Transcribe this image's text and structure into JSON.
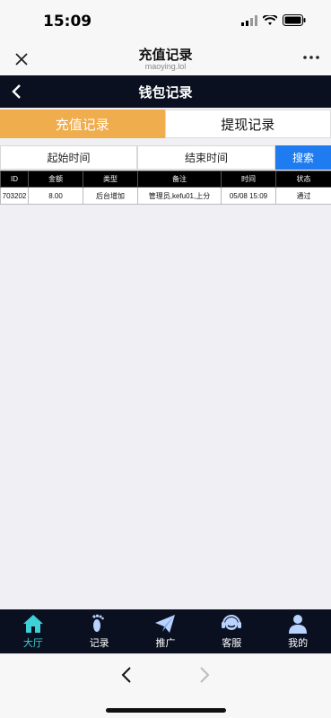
{
  "status_bar": {
    "time": "15:09"
  },
  "webview": {
    "title": "充值记录",
    "subtitle": "maoying.lol"
  },
  "app_nav": {
    "title": "钱包记录"
  },
  "tabs": [
    {
      "label": "充值记录",
      "active": true
    },
    {
      "label": "提现记录",
      "active": false
    }
  ],
  "filter": {
    "start_label": "起始时间",
    "end_label": "结束时间",
    "search_label": "搜索"
  },
  "table": {
    "headers": [
      "ID",
      "金额",
      "类型",
      "备注",
      "时间",
      "状态"
    ],
    "rows": [
      [
        "703202",
        "8.00",
        "后台增加",
        "管理员,kefu01,上分",
        "05/08 15:09",
        "通过"
      ]
    ]
  },
  "tabbar": [
    {
      "label": "大厅",
      "icon": "home-icon",
      "active": true
    },
    {
      "label": "记录",
      "icon": "footprint-icon",
      "active": false
    },
    {
      "label": "推广",
      "icon": "paper-plane-icon",
      "active": false
    },
    {
      "label": "客服",
      "icon": "headset-icon",
      "active": false
    },
    {
      "label": "我的",
      "icon": "user-icon",
      "active": false
    }
  ],
  "colors": {
    "accent": "#f0ad4e",
    "search": "#1e7cf0",
    "nav_bg": "#0b1020",
    "active_tab_icon": "#3dd0d6"
  }
}
